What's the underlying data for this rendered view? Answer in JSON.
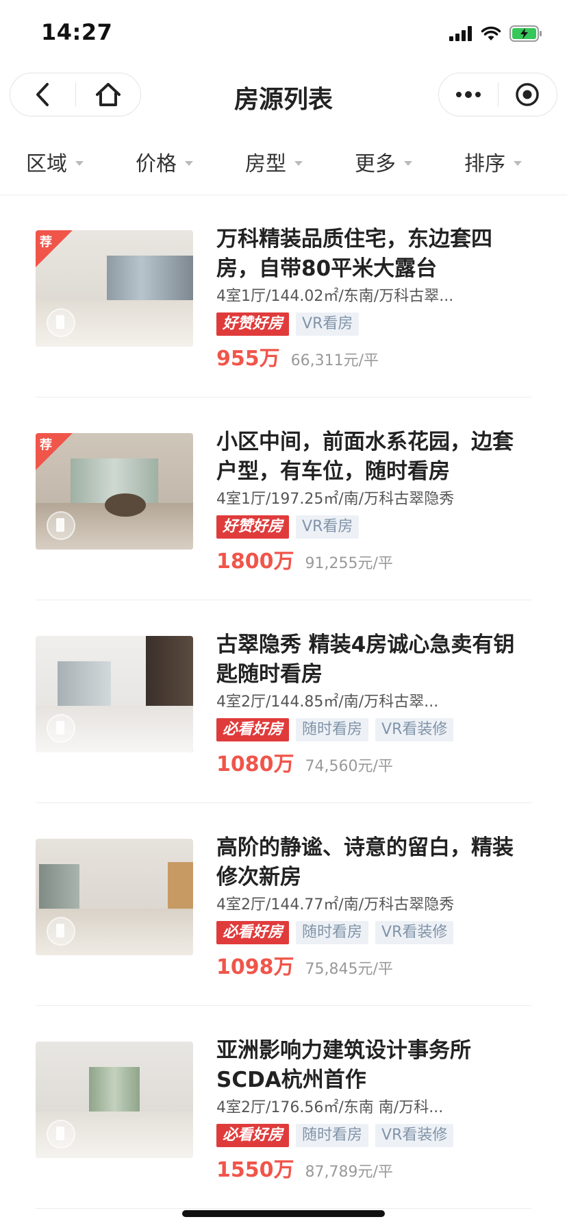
{
  "status_bar": {
    "time": "14:27"
  },
  "nav": {
    "title": "房源列表"
  },
  "filters": [
    {
      "label": "区域"
    },
    {
      "label": "价格"
    },
    {
      "label": "房型"
    },
    {
      "label": "更多"
    },
    {
      "label": "排序"
    }
  ],
  "colors": {
    "price": "#f0554a",
    "hot_tag": "#e03b3b",
    "plain_tag_bg": "#edf1f6",
    "plain_tag_text": "#8193a8"
  },
  "listings": [
    {
      "recommended": true,
      "badge": "荐",
      "title": "万科精装品质住宅，东边套四房，自带80平米大露台",
      "meta": "4室1厅/144.02㎡/东南/万科古翠...",
      "tags": [
        "好赞好房",
        "VR看房"
      ],
      "price": "955万",
      "unit_price": "66,311元/平"
    },
    {
      "recommended": true,
      "badge": "荐",
      "title": "小区中间，前面水系花园，边套户型，有车位，随时看房",
      "meta": "4室1厅/197.25㎡/南/万科古翠隐秀",
      "tags": [
        "好赞好房",
        "VR看房"
      ],
      "price": "1800万",
      "unit_price": "91,255元/平"
    },
    {
      "recommended": false,
      "title": "古翠隐秀 精装4房诚心急卖有钥匙随时看房",
      "meta": "4室2厅/144.85㎡/南/万科古翠...",
      "tags": [
        "必看好房",
        "随时看房",
        "VR看装修"
      ],
      "price": "1080万",
      "unit_price": "74,560元/平"
    },
    {
      "recommended": false,
      "title": "高阶的静谧、诗意的留白，精装修次新房",
      "meta": "4室2厅/144.77㎡/南/万科古翠隐秀",
      "tags": [
        "必看好房",
        "随时看房",
        "VR看装修"
      ],
      "price": "1098万",
      "unit_price": "75,845元/平"
    },
    {
      "recommended": false,
      "title": "亚洲影响力建筑设计事务所SCDA杭州首作",
      "meta": "4室2厅/176.56㎡/东南 南/万科...",
      "tags": [
        "必看好房",
        "随时看房",
        "VR看装修"
      ],
      "price": "1550万",
      "unit_price": "87,789元/平"
    }
  ]
}
